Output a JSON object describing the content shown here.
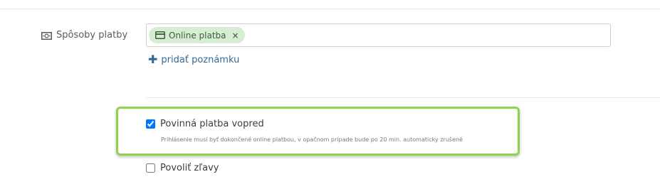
{
  "payment_methods": {
    "label": "Spôsoby platby",
    "label_icon": "money-icon",
    "tags": [
      {
        "label": "Online platba",
        "icon": "credit-card-icon",
        "remove": "×"
      }
    ],
    "add_note_label": "pridať poznámku"
  },
  "options": {
    "required_payment": {
      "label": "Povinná platba vopred",
      "checked": true,
      "help": "Prihlásenie musí byť dokončené online platbou, v opačnom prípade bude po 20 min. automaticky zrušené"
    },
    "allow_discounts": {
      "label": "Povoliť zľavy",
      "checked": false
    }
  },
  "colors": {
    "tag_bg": "#d6ecd3",
    "link": "#2f6b9a",
    "highlight": "#8fd14f"
  }
}
